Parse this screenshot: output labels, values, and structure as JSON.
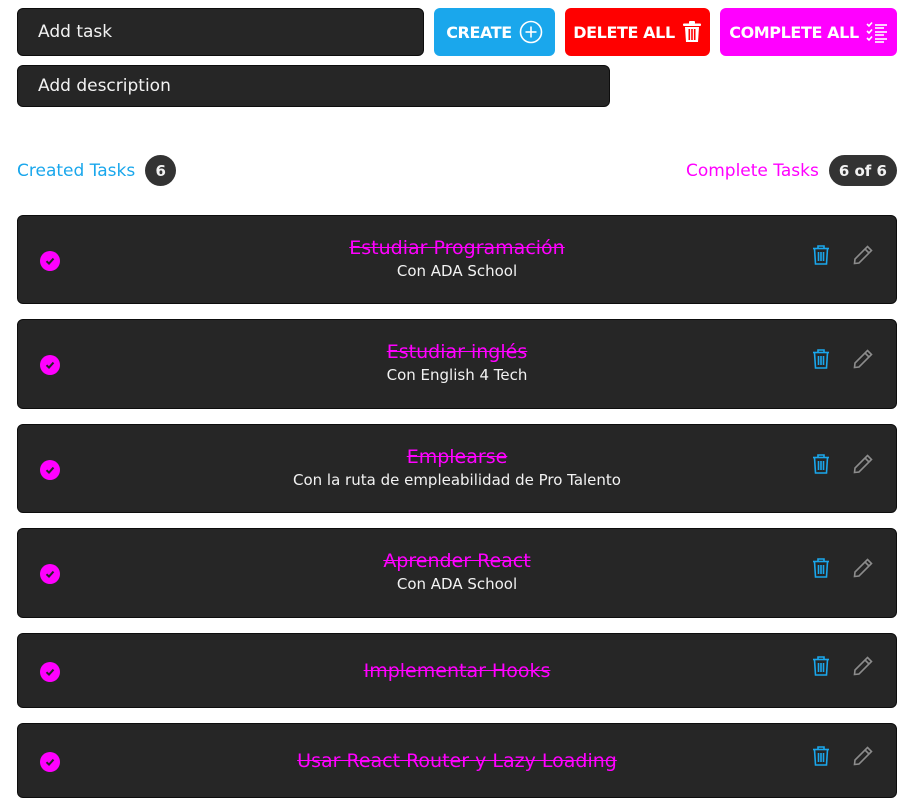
{
  "form": {
    "task_placeholder": "Add task",
    "description_placeholder": "Add description"
  },
  "buttons": {
    "create_label": "CREATE",
    "delete_all_label": "DELETE ALL",
    "complete_all_label": "COMPLETE ALL"
  },
  "icons": {
    "create": "plus-circle-icon",
    "delete_all": "trash-icon",
    "complete_all": "checklist-icon",
    "task_check": "check-circle-icon",
    "task_delete": "trash-icon",
    "task_edit": "pencil-icon"
  },
  "counters": {
    "created_label": "Created Tasks",
    "created_count": "6",
    "complete_label": "Complete Tasks",
    "complete_count": "6 of 6"
  },
  "tasks": [
    {
      "title": "Estudiar Programación",
      "description": "Con ADA School",
      "completed": true
    },
    {
      "title": "Estudiar inglés",
      "description": "Con English 4 Tech",
      "completed": true
    },
    {
      "title": "Emplearse",
      "description": "Con la ruta de empleabilidad de Pro Talento",
      "completed": true
    },
    {
      "title": "Aprender React",
      "description": "Con ADA School",
      "completed": true
    },
    {
      "title": "Implementar Hooks",
      "description": "",
      "completed": true
    },
    {
      "title": "Usar React Router y Lazy Loading",
      "description": "",
      "completed": true
    }
  ],
  "colors": {
    "accent_blue": "#1aa7ec",
    "accent_magenta": "#ff00ff",
    "danger_red": "#ff0000",
    "card_bg": "#262626"
  }
}
